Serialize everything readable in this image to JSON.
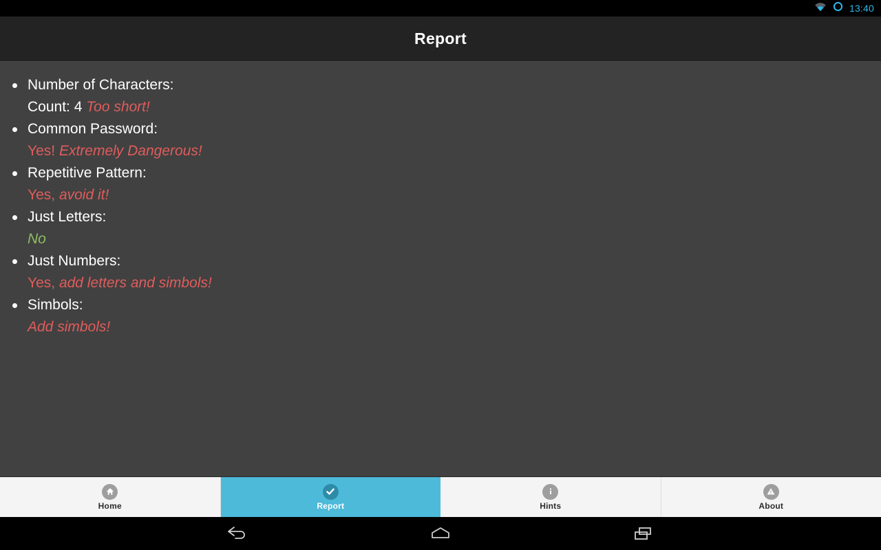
{
  "statusbar": {
    "clock": "13:40",
    "icons": [
      "wifi-icon",
      "sync-circle-icon"
    ],
    "accent_color": "#2fb8e8"
  },
  "appbar": {
    "title": "Report"
  },
  "report": {
    "items": [
      {
        "label": "Number of Characters:",
        "value_prefix": "Count: 4 ",
        "value_prefix_tone": "white",
        "value_em": "Too short!",
        "value_em_tone": "bad"
      },
      {
        "label": "Common Password:",
        "value_prefix": "Yes! ",
        "value_prefix_tone": "bad",
        "value_em": "Extremely Dangerous!",
        "value_em_tone": "bad"
      },
      {
        "label": "Repetitive Pattern:",
        "value_prefix": "Yes, ",
        "value_prefix_tone": "bad",
        "value_em": "avoid it!",
        "value_em_tone": "bad"
      },
      {
        "label": "Just Letters:",
        "value_prefix": "",
        "value_prefix_tone": "good",
        "value_em": "No",
        "value_em_tone": "good"
      },
      {
        "label": "Just Numbers:",
        "value_prefix": "Yes, ",
        "value_prefix_tone": "bad",
        "value_em": "add letters and simbols!",
        "value_em_tone": "bad"
      },
      {
        "label": "Simbols:",
        "value_prefix": "",
        "value_prefix_tone": "bad",
        "value_em": "Add simbols!",
        "value_em_tone": "bad"
      }
    ]
  },
  "tabbar": {
    "active_color": "#4dbada",
    "tabs": [
      {
        "label": "Home",
        "icon": "home-icon",
        "active": false
      },
      {
        "label": "Report",
        "icon": "check-icon",
        "active": true
      },
      {
        "label": "Hints",
        "icon": "info-icon",
        "active": false
      },
      {
        "label": "About",
        "icon": "warning-icon",
        "active": false
      }
    ]
  },
  "navbar": {
    "buttons": [
      {
        "name": "back-icon"
      },
      {
        "name": "home-icon"
      },
      {
        "name": "recents-icon"
      }
    ]
  },
  "colors": {
    "header_bg": "#232323",
    "content_bg": "#414141",
    "danger": "#e05c5c",
    "success": "#8dbd63"
  }
}
